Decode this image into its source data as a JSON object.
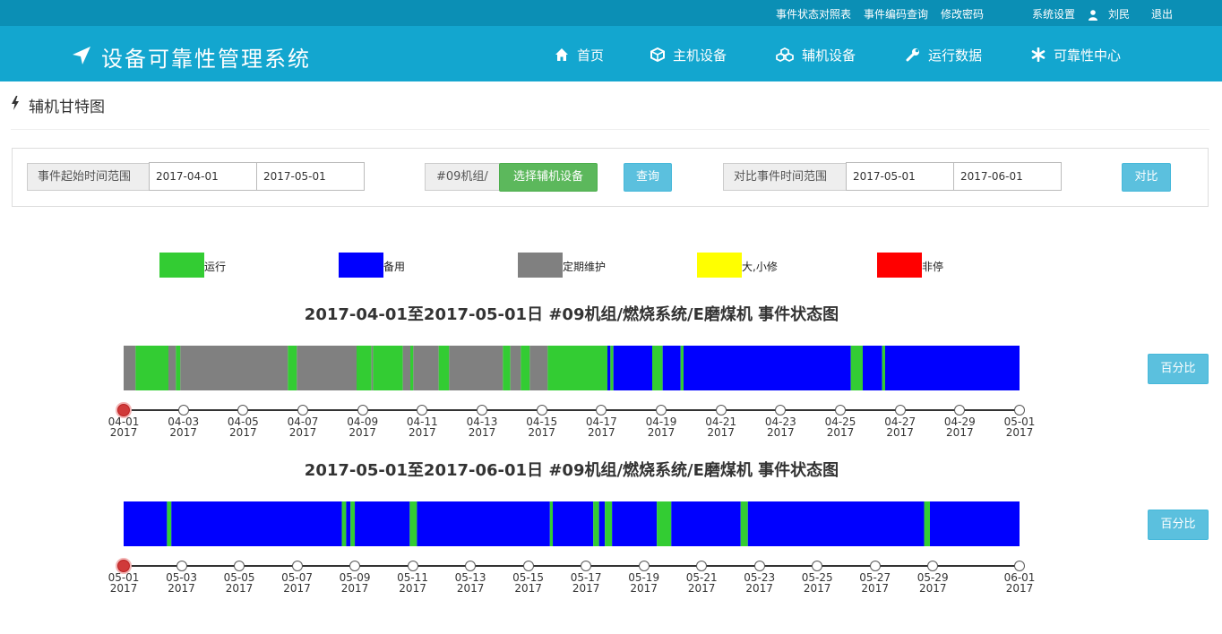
{
  "topbar": {
    "links": [
      "事件状态对照表",
      "事件编码查询",
      "修改密码"
    ],
    "settings": "系统设置",
    "user": "刘民",
    "logout": "退出"
  },
  "header": {
    "brand": "设备可靠性管理系统",
    "nav": [
      {
        "label": "首页",
        "icon": "home-icon"
      },
      {
        "label": "主机设备",
        "icon": "cube-icon"
      },
      {
        "label": "辅机设备",
        "icon": "cubes-icon"
      },
      {
        "label": "运行数据",
        "icon": "wrench-icon"
      },
      {
        "label": "可靠性中心",
        "icon": "asterisk-icon"
      }
    ]
  },
  "page_title": "辅机甘特图",
  "filter": {
    "range_label": "事件起始时间范围",
    "start": "2017-04-01",
    "end": "2017-05-01",
    "device_prefix": "#09机组/",
    "select_device": "选择辅机设备",
    "query": "查询",
    "compare_label": "对比事件时间范围",
    "compare_start": "2017-05-01",
    "compare_end": "2017-06-01",
    "compare": "对比"
  },
  "legend": [
    {
      "label": "运行",
      "color": "#33cc33"
    },
    {
      "label": "备用",
      "color": "#0000ff"
    },
    {
      "label": "定期维护",
      "color": "#808080"
    },
    {
      "label": "大,小修",
      "color": "#ffff00"
    },
    {
      "label": "非停",
      "color": "#ff0000"
    }
  ],
  "percent_label": "百分比",
  "chart_data": [
    {
      "type": "gantt",
      "title": "2017-04-01至2017-05-01日 #09机组/燃烧系统/E磨煤机 事件状态图",
      "range_days": 30,
      "segments": [
        {
          "start": 0.0,
          "end": 0.4,
          "state": "定期维护"
        },
        {
          "start": 0.4,
          "end": 1.5,
          "state": "运行"
        },
        {
          "start": 1.5,
          "end": 1.75,
          "state": "定期维护"
        },
        {
          "start": 1.75,
          "end": 1.9,
          "state": "运行"
        },
        {
          "start": 1.9,
          "end": 5.5,
          "state": "定期维护"
        },
        {
          "start": 5.5,
          "end": 5.8,
          "state": "运行"
        },
        {
          "start": 5.8,
          "end": 7.8,
          "state": "定期维护"
        },
        {
          "start": 7.8,
          "end": 8.3,
          "state": "运行"
        },
        {
          "start": 8.3,
          "end": 8.35,
          "state": "定期维护"
        },
        {
          "start": 8.35,
          "end": 9.35,
          "state": "运行"
        },
        {
          "start": 9.35,
          "end": 9.6,
          "state": "定期维护"
        },
        {
          "start": 9.6,
          "end": 9.7,
          "state": "运行"
        },
        {
          "start": 9.7,
          "end": 10.55,
          "state": "定期维护"
        },
        {
          "start": 10.55,
          "end": 10.9,
          "state": "运行"
        },
        {
          "start": 10.9,
          "end": 12.7,
          "state": "定期维护"
        },
        {
          "start": 12.7,
          "end": 12.95,
          "state": "运行"
        },
        {
          "start": 12.95,
          "end": 13.3,
          "state": "定期维护"
        },
        {
          "start": 13.3,
          "end": 13.6,
          "state": "运行"
        },
        {
          "start": 13.6,
          "end": 14.2,
          "state": "定期维护"
        },
        {
          "start": 14.2,
          "end": 16.2,
          "state": "运行"
        },
        {
          "start": 16.2,
          "end": 16.3,
          "state": "备用"
        },
        {
          "start": 16.3,
          "end": 16.4,
          "state": "运行"
        },
        {
          "start": 16.4,
          "end": 17.7,
          "state": "备用"
        },
        {
          "start": 17.7,
          "end": 18.05,
          "state": "运行"
        },
        {
          "start": 18.05,
          "end": 18.65,
          "state": "备用"
        },
        {
          "start": 18.65,
          "end": 18.75,
          "state": "运行"
        },
        {
          "start": 18.75,
          "end": 24.35,
          "state": "备用"
        },
        {
          "start": 24.35,
          "end": 24.75,
          "state": "运行"
        },
        {
          "start": 24.75,
          "end": 25.4,
          "state": "备用"
        },
        {
          "start": 25.4,
          "end": 25.5,
          "state": "运行"
        },
        {
          "start": 25.5,
          "end": 30.0,
          "state": "备用"
        }
      ],
      "ticks": [
        {
          "day": 0,
          "md": "04-01",
          "y": "2017"
        },
        {
          "day": 2,
          "md": "04-03",
          "y": "2017"
        },
        {
          "day": 4,
          "md": "04-05",
          "y": "2017"
        },
        {
          "day": 6,
          "md": "04-07",
          "y": "2017"
        },
        {
          "day": 8,
          "md": "04-09",
          "y": "2017"
        },
        {
          "day": 10,
          "md": "04-11",
          "y": "2017"
        },
        {
          "day": 12,
          "md": "04-13",
          "y": "2017"
        },
        {
          "day": 14,
          "md": "04-15",
          "y": "2017"
        },
        {
          "day": 16,
          "md": "04-17",
          "y": "2017"
        },
        {
          "day": 18,
          "md": "04-19",
          "y": "2017"
        },
        {
          "day": 20,
          "md": "04-21",
          "y": "2017"
        },
        {
          "day": 22,
          "md": "04-23",
          "y": "2017"
        },
        {
          "day": 24,
          "md": "04-25",
          "y": "2017"
        },
        {
          "day": 26,
          "md": "04-27",
          "y": "2017"
        },
        {
          "day": 28,
          "md": "04-29",
          "y": "2017"
        },
        {
          "day": 30,
          "md": "05-01",
          "y": "2017"
        }
      ]
    },
    {
      "type": "gantt",
      "title": "2017-05-01至2017-06-01日 #09机组/燃烧系统/E磨煤机 事件状态图",
      "range_days": 31,
      "segments": [
        {
          "start": 0.0,
          "end": 1.5,
          "state": "备用"
        },
        {
          "start": 1.5,
          "end": 1.65,
          "state": "运行"
        },
        {
          "start": 1.65,
          "end": 7.55,
          "state": "备用"
        },
        {
          "start": 7.55,
          "end": 7.7,
          "state": "运行"
        },
        {
          "start": 7.7,
          "end": 7.85,
          "state": "备用"
        },
        {
          "start": 7.85,
          "end": 8.0,
          "state": "运行"
        },
        {
          "start": 8.0,
          "end": 9.9,
          "state": "备用"
        },
        {
          "start": 9.9,
          "end": 10.15,
          "state": "运行"
        },
        {
          "start": 10.15,
          "end": 14.75,
          "state": "备用"
        },
        {
          "start": 14.75,
          "end": 14.85,
          "state": "运行"
        },
        {
          "start": 14.85,
          "end": 16.25,
          "state": "备用"
        },
        {
          "start": 16.25,
          "end": 16.45,
          "state": "运行"
        },
        {
          "start": 16.45,
          "end": 16.65,
          "state": "备用"
        },
        {
          "start": 16.65,
          "end": 16.9,
          "state": "运行"
        },
        {
          "start": 16.9,
          "end": 18.45,
          "state": "备用"
        },
        {
          "start": 18.45,
          "end": 18.95,
          "state": "运行"
        },
        {
          "start": 18.95,
          "end": 21.35,
          "state": "备用"
        },
        {
          "start": 21.35,
          "end": 21.6,
          "state": "运行"
        },
        {
          "start": 21.6,
          "end": 27.7,
          "state": "备用"
        },
        {
          "start": 27.7,
          "end": 27.9,
          "state": "运行"
        },
        {
          "start": 27.9,
          "end": 31.0,
          "state": "备用"
        }
      ],
      "ticks": [
        {
          "day": 0,
          "md": "05-01",
          "y": "2017"
        },
        {
          "day": 2,
          "md": "05-03",
          "y": "2017"
        },
        {
          "day": 4,
          "md": "05-05",
          "y": "2017"
        },
        {
          "day": 6,
          "md": "05-07",
          "y": "2017"
        },
        {
          "day": 8,
          "md": "05-09",
          "y": "2017"
        },
        {
          "day": 10,
          "md": "05-11",
          "y": "2017"
        },
        {
          "day": 12,
          "md": "05-13",
          "y": "2017"
        },
        {
          "day": 14,
          "md": "05-15",
          "y": "2017"
        },
        {
          "day": 16,
          "md": "05-17",
          "y": "2017"
        },
        {
          "day": 18,
          "md": "05-19",
          "y": "2017"
        },
        {
          "day": 20,
          "md": "05-21",
          "y": "2017"
        },
        {
          "day": 22,
          "md": "05-23",
          "y": "2017"
        },
        {
          "day": 24,
          "md": "05-25",
          "y": "2017"
        },
        {
          "day": 26,
          "md": "05-27",
          "y": "2017"
        },
        {
          "day": 28,
          "md": "05-29",
          "y": "2017"
        },
        {
          "day": 31,
          "md": "06-01",
          "y": "2017"
        }
      ]
    }
  ]
}
